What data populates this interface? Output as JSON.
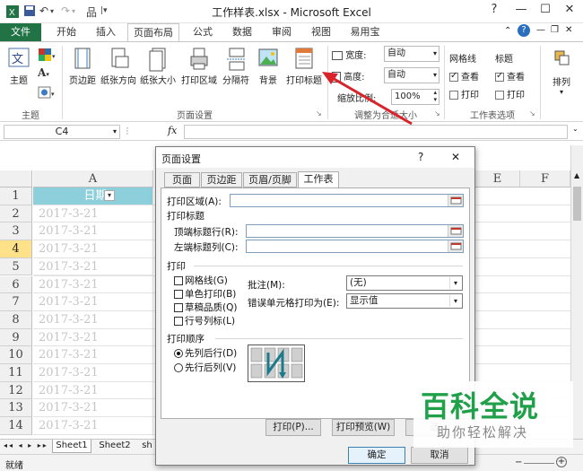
{
  "titlebar": {
    "title": "工作样表.xlsx - Microsoft Excel",
    "help": "?",
    "minimize": "—",
    "restore": "☐",
    "close": "✕"
  },
  "tabs": [
    "文件",
    "开始",
    "插入",
    "页面布局",
    "公式",
    "数据",
    "审阅",
    "视图",
    "易用宝"
  ],
  "ribbon": {
    "themes_group": {
      "theme_label": "主题",
      "group": "主题"
    },
    "page_setup": {
      "buttons": [
        "页边距",
        "纸张方向",
        "纸张大小",
        "打印区域",
        "分隔符",
        "背景",
        "打印标题"
      ],
      "group": "页面设置"
    },
    "scale": {
      "width_label": "宽度:",
      "width_value": "自动",
      "height_label": "高度:",
      "height_value": "自动",
      "scale_label": "缩放比例:",
      "scale_value": "100%",
      "group": "调整为合适大小"
    },
    "sheet_options": {
      "gridlines": "网格线",
      "headings": "标题",
      "view": "查看",
      "print": "打印",
      "gridlines_view": true,
      "gridlines_print": false,
      "headings_view": true,
      "headings_print": false,
      "group": "工作表选项"
    },
    "arrange": {
      "label": "排列"
    }
  },
  "formula_bar": {
    "name_box": "C4",
    "fx": "fx"
  },
  "grid": {
    "columns": [
      "A",
      "E",
      "F"
    ],
    "header_cell": "日期",
    "rows": [
      {
        "num": "1",
        "value": "日期"
      },
      {
        "num": "2",
        "value": "2017-3-21"
      },
      {
        "num": "3",
        "value": "2017-3-21"
      },
      {
        "num": "4",
        "value": "2017-3-21"
      },
      {
        "num": "5",
        "value": "2017-3-21"
      },
      {
        "num": "6",
        "value": "2017-3-21"
      },
      {
        "num": "7",
        "value": "2017-3-21"
      },
      {
        "num": "8",
        "value": "2017-3-21"
      },
      {
        "num": "9",
        "value": "2017-3-21"
      },
      {
        "num": "10",
        "value": "2017-3-21"
      },
      {
        "num": "11",
        "value": "2017-3-21"
      },
      {
        "num": "12",
        "value": "2017-3-21"
      },
      {
        "num": "13",
        "value": "2017-3-21"
      },
      {
        "num": "14",
        "value": "2017-3-21"
      }
    ],
    "selected_row": "4"
  },
  "sheets": [
    "Sheet1",
    "Sheet2",
    "sh"
  ],
  "status": {
    "mode": "就绪"
  },
  "dialog": {
    "title": "页面设置",
    "help": "?",
    "close": "✕",
    "tabs": [
      "页面",
      "页边距",
      "页眉/页脚",
      "工作表"
    ],
    "active_tab": "工作表",
    "print_area_label": "打印区域(A):",
    "print_titles_label": "打印标题",
    "top_rows_label": "顶端标题行(R):",
    "left_cols_label": "左端标题列(C):",
    "print_label": "打印",
    "checks": [
      "网格线(G)",
      "单色打印(B)",
      "草稿品质(Q)",
      "行号列标(L)"
    ],
    "comments_label": "批注(M):",
    "comments_value": "(无)",
    "errors_label": "错误单元格打印为(E):",
    "errors_value": "显示值",
    "order_label": "打印顺序",
    "order_options": [
      "先列后行(D)",
      "先行后列(V)"
    ],
    "print_button": "打印(P)...",
    "preview_button": "打印预览(W)",
    "options_button": "选",
    "ok_button": "确定",
    "cancel_button": "取消"
  },
  "watermark": {
    "big": "百科全说",
    "small": "助你轻松解决"
  },
  "colors": {
    "excel_green": "#217346",
    "header_fill": "#8ecfdc",
    "selection_row": "#ffe18a",
    "arrow": "#d9232a",
    "watermark_green": "#21a04a"
  }
}
